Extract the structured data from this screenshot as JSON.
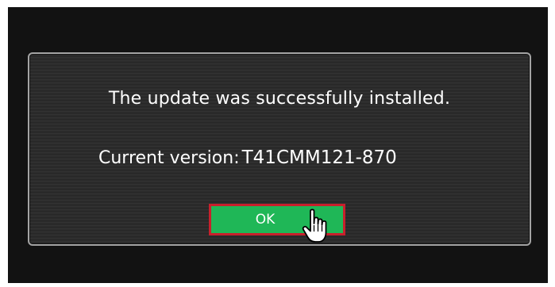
{
  "dialog": {
    "message": "The update was successfully installed.",
    "version_label": "Current version:",
    "version_value": "T41CMM121-870",
    "ok_label": "OK"
  },
  "colors": {
    "screen_bg": "#121212",
    "dialog_bg": "#2a2a2a",
    "dialog_border": "#a3a3a3",
    "ok_fill": "#1fb757",
    "ok_focus_border": "#c8202c",
    "text": "#ffffff"
  },
  "icons": {
    "pointer": "hand-pointer-icon"
  }
}
